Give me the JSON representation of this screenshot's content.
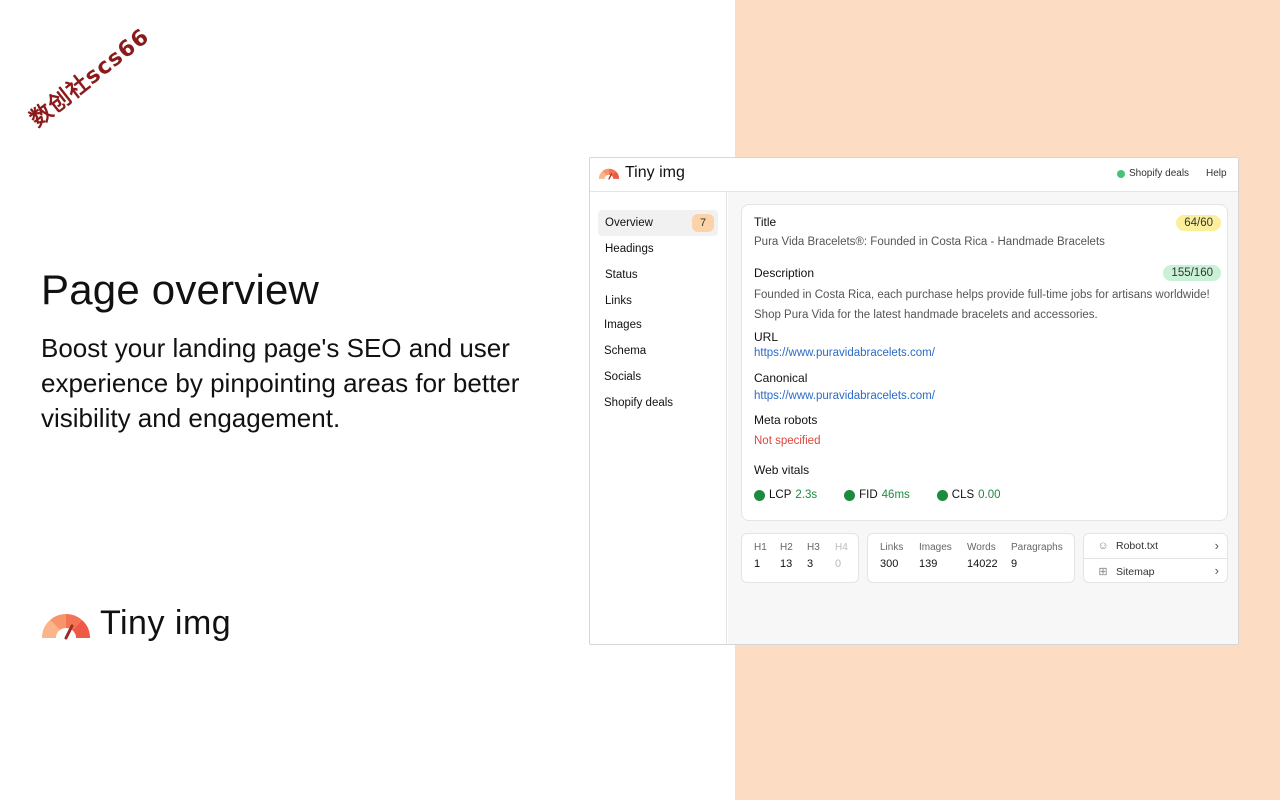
{
  "watermark": "数创社scs66",
  "hero": {
    "title": "Page overview",
    "subtitle": "Boost your landing page's SEO and user experience by pinpointing areas for better visibility and engagement."
  },
  "brand": {
    "name": "Tiny img"
  },
  "app": {
    "logo": "Tiny img",
    "topbar": {
      "shopify_deals": "Shopify deals",
      "help": "Help"
    },
    "sidebar": {
      "items": [
        {
          "label": "Overview",
          "badge": "7"
        },
        {
          "label": "Headings"
        },
        {
          "label": "Status"
        },
        {
          "label": "Links"
        },
        {
          "label": "Images"
        },
        {
          "label": "Schema"
        },
        {
          "label": "Socials"
        },
        {
          "label": "Shopify deals"
        }
      ]
    },
    "overview": {
      "title_label": "Title",
      "title_count": "64/60",
      "title_value": "Pura Vida Bracelets®: Founded in Costa Rica - Handmade Bracelets",
      "description_label": "Description",
      "description_count": "155/160",
      "description_value": "Founded in Costa Rica, each purchase helps provide full-time jobs for artisans worldwide! Shop Pura Vida for the latest handmade bracelets and accessories.",
      "url_label": "URL",
      "url_value": "https://www.puravidabracelets.com/",
      "canonical_label": "Canonical",
      "canonical_value": "https://www.puravidabracelets.com/",
      "meta_robots_label": "Meta robots",
      "meta_robots_value": "Not specified",
      "web_vitals_label": "Web vitals",
      "vitals": [
        {
          "name": "LCP",
          "value": "2.3s"
        },
        {
          "name": "FID",
          "value": "46ms"
        },
        {
          "name": "CLS",
          "value": "0.00"
        }
      ]
    },
    "headings": [
      {
        "label": "H1",
        "value": "1"
      },
      {
        "label": "H2",
        "value": "13"
      },
      {
        "label": "H3",
        "value": "3"
      },
      {
        "label": "H4",
        "value": "0"
      }
    ],
    "counts": [
      {
        "label": "Links",
        "value": "300"
      },
      {
        "label": "Images",
        "value": "139"
      },
      {
        "label": "Words",
        "value": "14022"
      },
      {
        "label": "Paragraphs",
        "value": "9"
      }
    ],
    "resources": [
      {
        "label": "Robot.txt",
        "icon": "robot-icon"
      },
      {
        "label": "Sitemap",
        "icon": "sitemap-icon"
      }
    ]
  },
  "colors": {
    "accent_bg": "#fddcc4",
    "link": "#2a6bc9",
    "good": "#1e8a3f",
    "error": "#e0453a"
  }
}
